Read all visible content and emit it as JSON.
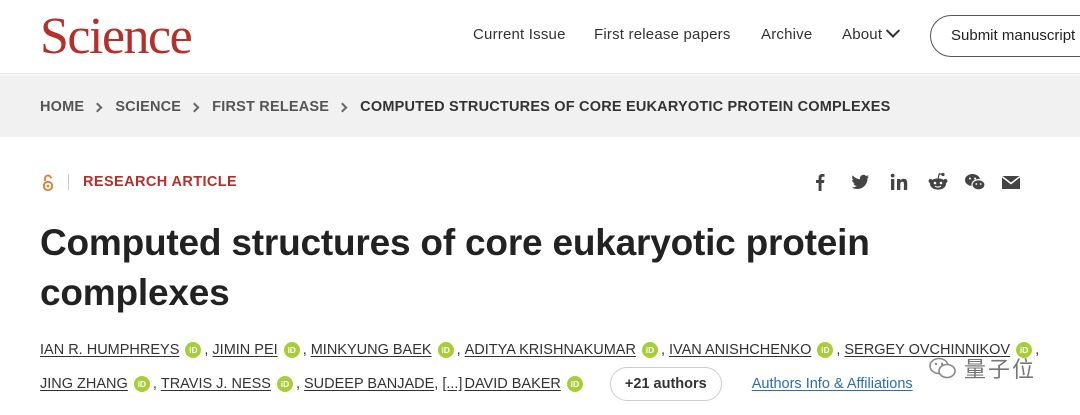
{
  "header": {
    "logo": "Science",
    "nav": {
      "current_issue": "Current Issue",
      "first_release": "First release papers",
      "archive": "Archive",
      "about": "About"
    },
    "submit_label": "Submit manuscript"
  },
  "breadcrumb": {
    "items": [
      "HOME",
      "SCIENCE",
      "FIRST RELEASE"
    ],
    "current": "COMPUTED STRUCTURES OF CORE EUKARYOTIC PROTEIN COMPLEXES"
  },
  "article": {
    "type": "RESEARCH ARTICLE",
    "title": "Computed structures of core eukaryotic protein complexes",
    "share_icons": [
      "facebook-icon",
      "twitter-icon",
      "linkedin-icon",
      "reddit-icon",
      "wechat-icon",
      "email-icon"
    ],
    "authors_line1": [
      {
        "name": "IAN R. HUMPHREYS",
        "orcid": true
      },
      {
        "name": "JIMIN PEI",
        "orcid": true
      },
      {
        "name": "MINKYUNG BAEK",
        "orcid": true
      },
      {
        "name": "ADITYA KRISHNAKUMAR",
        "orcid": true
      },
      {
        "name": "IVAN ANISHCHENKO",
        "orcid": true
      },
      {
        "name": "SERGEY OVCHINNIKOV",
        "orcid": true
      }
    ],
    "authors_line2": [
      {
        "name": "JING ZHANG",
        "orcid": true
      },
      {
        "name": "TRAVIS J. NESS",
        "orcid": true
      },
      {
        "name": "SUDEEP BANJADE",
        "orcid": false
      }
    ],
    "ellipsis": "[...]",
    "last_author": "DAVID BAKER",
    "orcid_label": "iD",
    "more_authors": "+21 authors",
    "affiliations_link": "Authors Info & Affiliations"
  },
  "watermark": "量子位",
  "colors": {
    "brand_red": "#b5302a",
    "link_blue": "#2a6db0",
    "orcid_green": "#a6ce39",
    "crumb_bg": "#f1f1f1"
  }
}
